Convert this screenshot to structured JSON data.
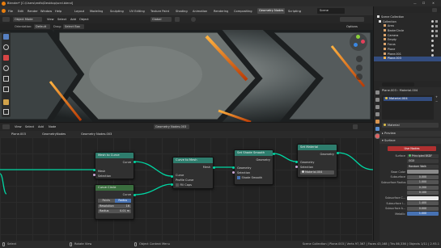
{
  "window": {
    "title": "Blender* [C:\\Users\\redfo\\Desktop\\scrd.blend]"
  },
  "menu": {
    "items": [
      "File",
      "Edit",
      "Render",
      "Window",
      "Help"
    ],
    "workspaces": [
      "Layout",
      "Modeling",
      "Sculpting",
      "UV Editing",
      "Texture Paint",
      "Shading",
      "Animation",
      "Rendering",
      "Compositing",
      "Geometry Nodes",
      "Scripting"
    ],
    "scene_label": "Scene",
    "viewlayer_label": "ViewLayer"
  },
  "viewport": {
    "mode": "Object Mode",
    "menus": [
      "View",
      "Select",
      "Add",
      "Object"
    ],
    "transform": "Global",
    "orientation_label": "Orientation:",
    "orientation_value": "Default",
    "drag_label": "Drag:",
    "drag_value": "Select Box",
    "options": "Options"
  },
  "node_editor": {
    "editor_menus": [
      "View",
      "Select",
      "Add",
      "Node"
    ],
    "tree_name": "Geometry Nodes.003",
    "breadcrumb": [
      "Plane.003",
      "GeometryNodes",
      "Geometry Nodes.003"
    ],
    "nodes": {
      "mesh_to_curve": {
        "title": "Mesh to Curve",
        "out": "Curve",
        "in1": "Mesh",
        "in2": "Selection"
      },
      "curve_to_mesh": {
        "title": "Curve to Mesh",
        "out": "Mesh",
        "in1": "Curve",
        "in2": "Profile Curve",
        "in3": "Fill Caps"
      },
      "curve_circle": {
        "title": "Curve Circle",
        "out": "Curve",
        "opt1": "Points",
        "opt2": "Radius",
        "res_label": "Resolution",
        "res_val": "16",
        "rad_label": "Radius",
        "rad_val": "0.01 m"
      },
      "set_shade_smooth": {
        "title": "Set Shade Smooth",
        "out": "Geometry",
        "in1": "Geometry",
        "in2": "Selection",
        "in3": "Shade Smooth"
      },
      "set_material": {
        "title": "Set Material",
        "out": "Geometry",
        "in1": "Geometry",
        "in2": "Selection",
        "mat": "Material.004"
      }
    }
  },
  "outliner": {
    "header": "Scene Collection",
    "items": [
      {
        "label": "Collection",
        "color": "#e0e0e0"
      },
      {
        "label": "Area",
        "color": "#d9a36b"
      },
      {
        "label": "BezierCircle",
        "color": "#d9a36b"
      },
      {
        "label": "Camera",
        "color": "#d9a36b"
      },
      {
        "label": "Empty",
        "color": "#d9a36b"
      },
      {
        "label": "Focus",
        "color": "#d9a36b"
      },
      {
        "label": "Plane",
        "color": "#d9a36b"
      },
      {
        "label": "Plane.001",
        "color": "#d9a36b"
      },
      {
        "label": "Plane.003",
        "color": "#ffb54d"
      }
    ]
  },
  "properties": {
    "object": "Plane.003",
    "material_tab": "Material.004",
    "slot": "Material.004",
    "material_name": "Material",
    "preview_label": "Preview",
    "surface_label": "Surface",
    "use_nodes": "Use Nodes",
    "surface_field": "Surface",
    "surface_value": "Principled BSDF",
    "rows": [
      {
        "label": "",
        "value": "GGX"
      },
      {
        "label": "",
        "value": "Random Walk"
      },
      {
        "label": "Base Color",
        "value": ""
      },
      {
        "label": "Subsurface",
        "value": "0.000"
      },
      {
        "label": "Subsurface Radius",
        "value": "1.000"
      },
      {
        "label": "",
        "value": "0.200"
      },
      {
        "label": "",
        "value": "0.100"
      },
      {
        "label": "Subsurface C...",
        "value": ""
      },
      {
        "label": "Subsurface I...",
        "value": "1.400"
      },
      {
        "label": "Subsurface A...",
        "value": "0.000"
      },
      {
        "label": "Metallic",
        "value": "1.000"
      }
    ]
  },
  "status": {
    "select": "Select",
    "rotate": "Rotate View",
    "context": "Object Context Menu",
    "info": "Scene Collection | Plane.003 | Verts 97,367 | Faces 43,168 | Tris 86,336 | Objects 1/11 | 2.93.1"
  },
  "colors": {
    "accent": "#e06d1f",
    "geo_node": "#2e7d6d",
    "curve_node": "#3a6e3e",
    "selected_border": "#ffffff",
    "geometry_socket": "#00d6a3",
    "float_socket": "#a1a1a1",
    "bool_socket": "#cca6d6",
    "material_socket": "#eb7582",
    "use_nodes": "#b03030"
  }
}
